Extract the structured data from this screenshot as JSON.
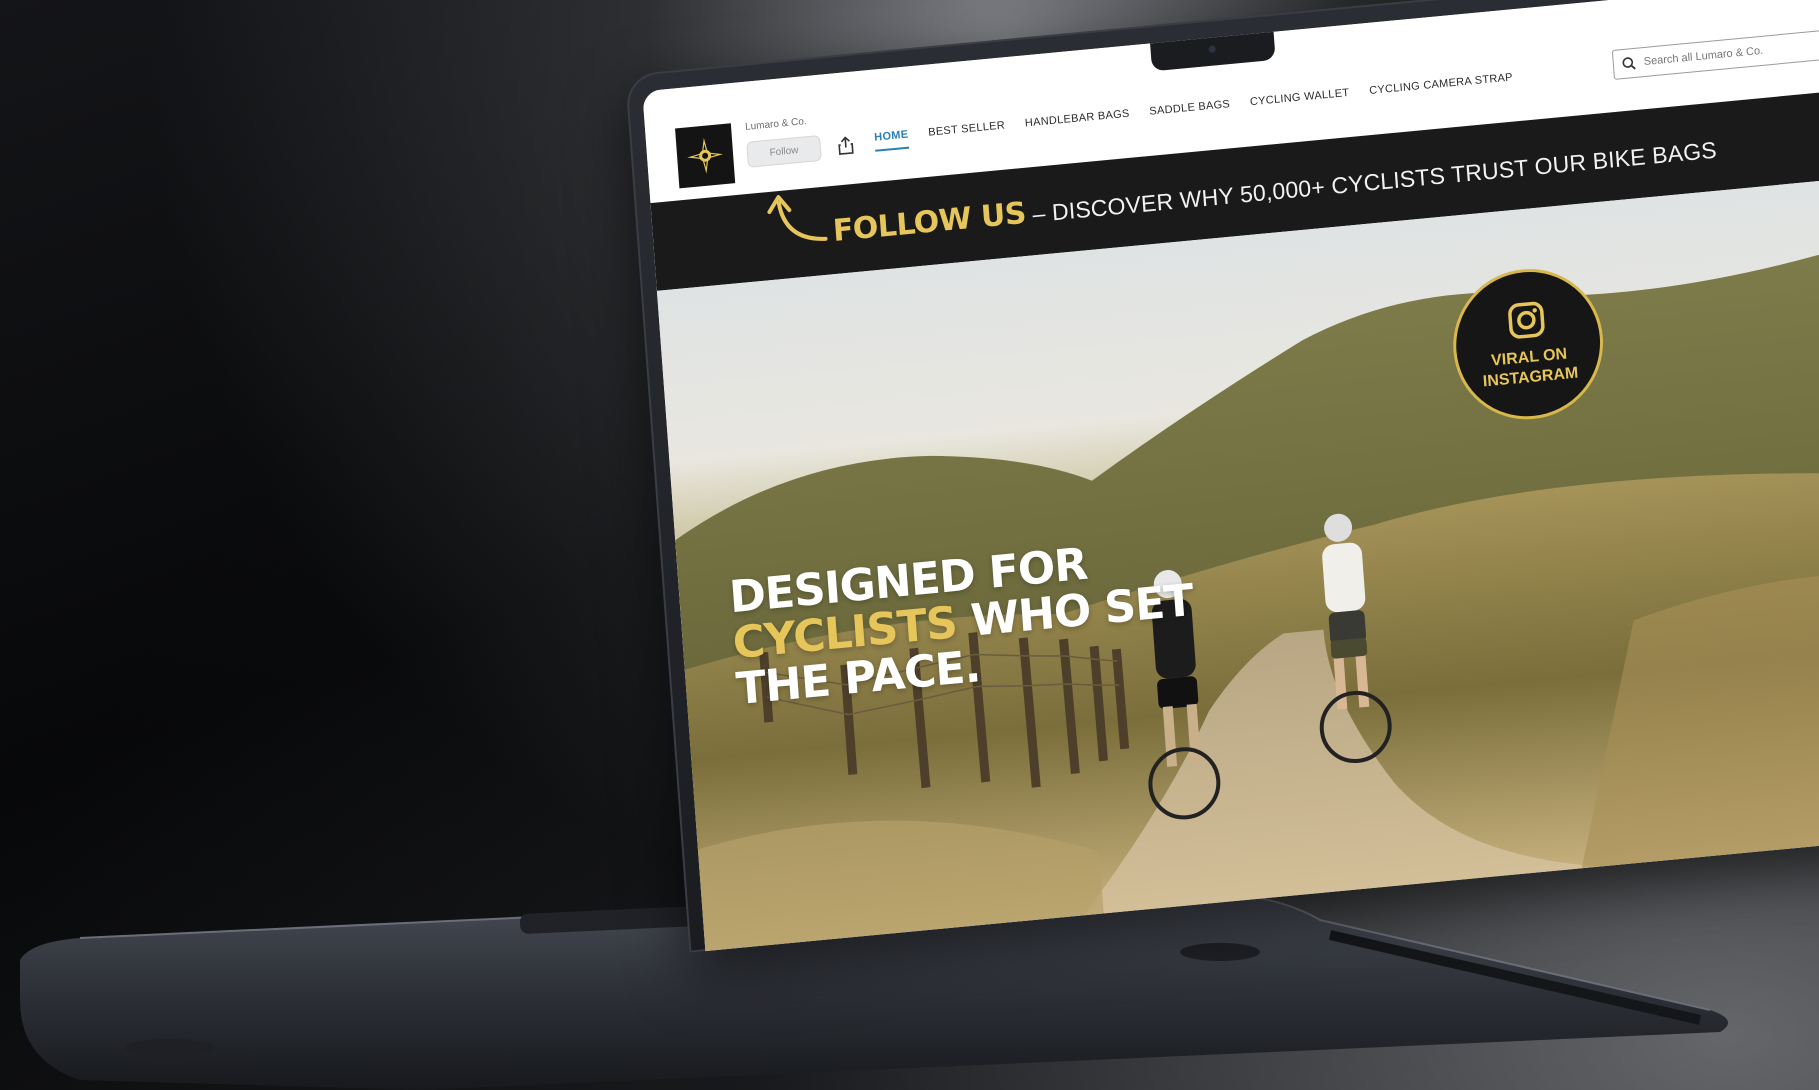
{
  "site": {
    "brand_name": "Lumaro & Co.",
    "follow_label": "Follow"
  },
  "nav": {
    "items": [
      {
        "label": "HOME",
        "active": true
      },
      {
        "label": "BEST SELLER",
        "active": false
      },
      {
        "label": "HANDLEBAR BAGS",
        "active": false
      },
      {
        "label": "SADDLE BAGS",
        "active": false
      },
      {
        "label": "CYCLING WALLET",
        "active": false
      },
      {
        "label": "CYCLING CAMERA STRAP",
        "active": false
      }
    ]
  },
  "search": {
    "placeholder": "Search all Lumaro & Co."
  },
  "announcement": {
    "strong": "FOLLOW US",
    "rest": " – DISCOVER WHY 50,000+ CYCLISTS TRUST OUR BIKE BAGS"
  },
  "hero": {
    "line1": "DESIGNED FOR",
    "line2_accent": "CYCLISTS",
    "line2_rest": " WHO SET",
    "line3": "THE PACE."
  },
  "badge": {
    "text": "VIRAL ON INSTAGRAM",
    "icon": "instagram-icon"
  },
  "icons": {
    "logo": "compass-star-icon",
    "share": "share-icon",
    "search": "search-icon",
    "arrow": "curved-arrow-icon"
  },
  "colors": {
    "accent_gold": "#e6c65a",
    "nav_active": "#2a7fb8",
    "band_bg": "#1a1a1a"
  }
}
